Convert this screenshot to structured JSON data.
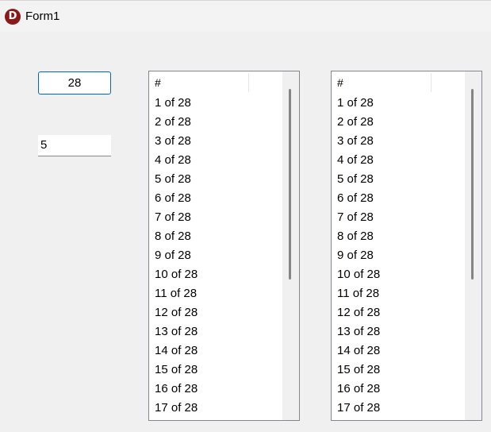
{
  "window": {
    "title": "Form1",
    "icon": "delphi-logo-icon",
    "icon_letter": "D"
  },
  "edit_top": {
    "value": "28"
  },
  "edit_bottom": {
    "value": "5"
  },
  "listbox1": {
    "header": "#",
    "rows": [
      "1 of 28",
      "2 of 28",
      "3 of 28",
      "4 of 28",
      "5 of 28",
      "6 of 28",
      "7 of 28",
      "8 of 28",
      "9 of 28",
      "10 of 28",
      "11 of 28",
      "12 of 28",
      "13 of 28",
      "14 of 28",
      "15 of 28",
      "16 of 28",
      "17 of 28"
    ]
  },
  "listbox2": {
    "header": "#",
    "rows": [
      "1 of 28",
      "2 of 28",
      "3 of 28",
      "4 of 28",
      "5 of 28",
      "6 of 28",
      "7 of 28",
      "8 of 28",
      "9 of 28",
      "10 of 28",
      "11 of 28",
      "12 of 28",
      "13 of 28",
      "14 of 28",
      "15 of 28",
      "16 of 28",
      "17 of 28"
    ]
  }
}
